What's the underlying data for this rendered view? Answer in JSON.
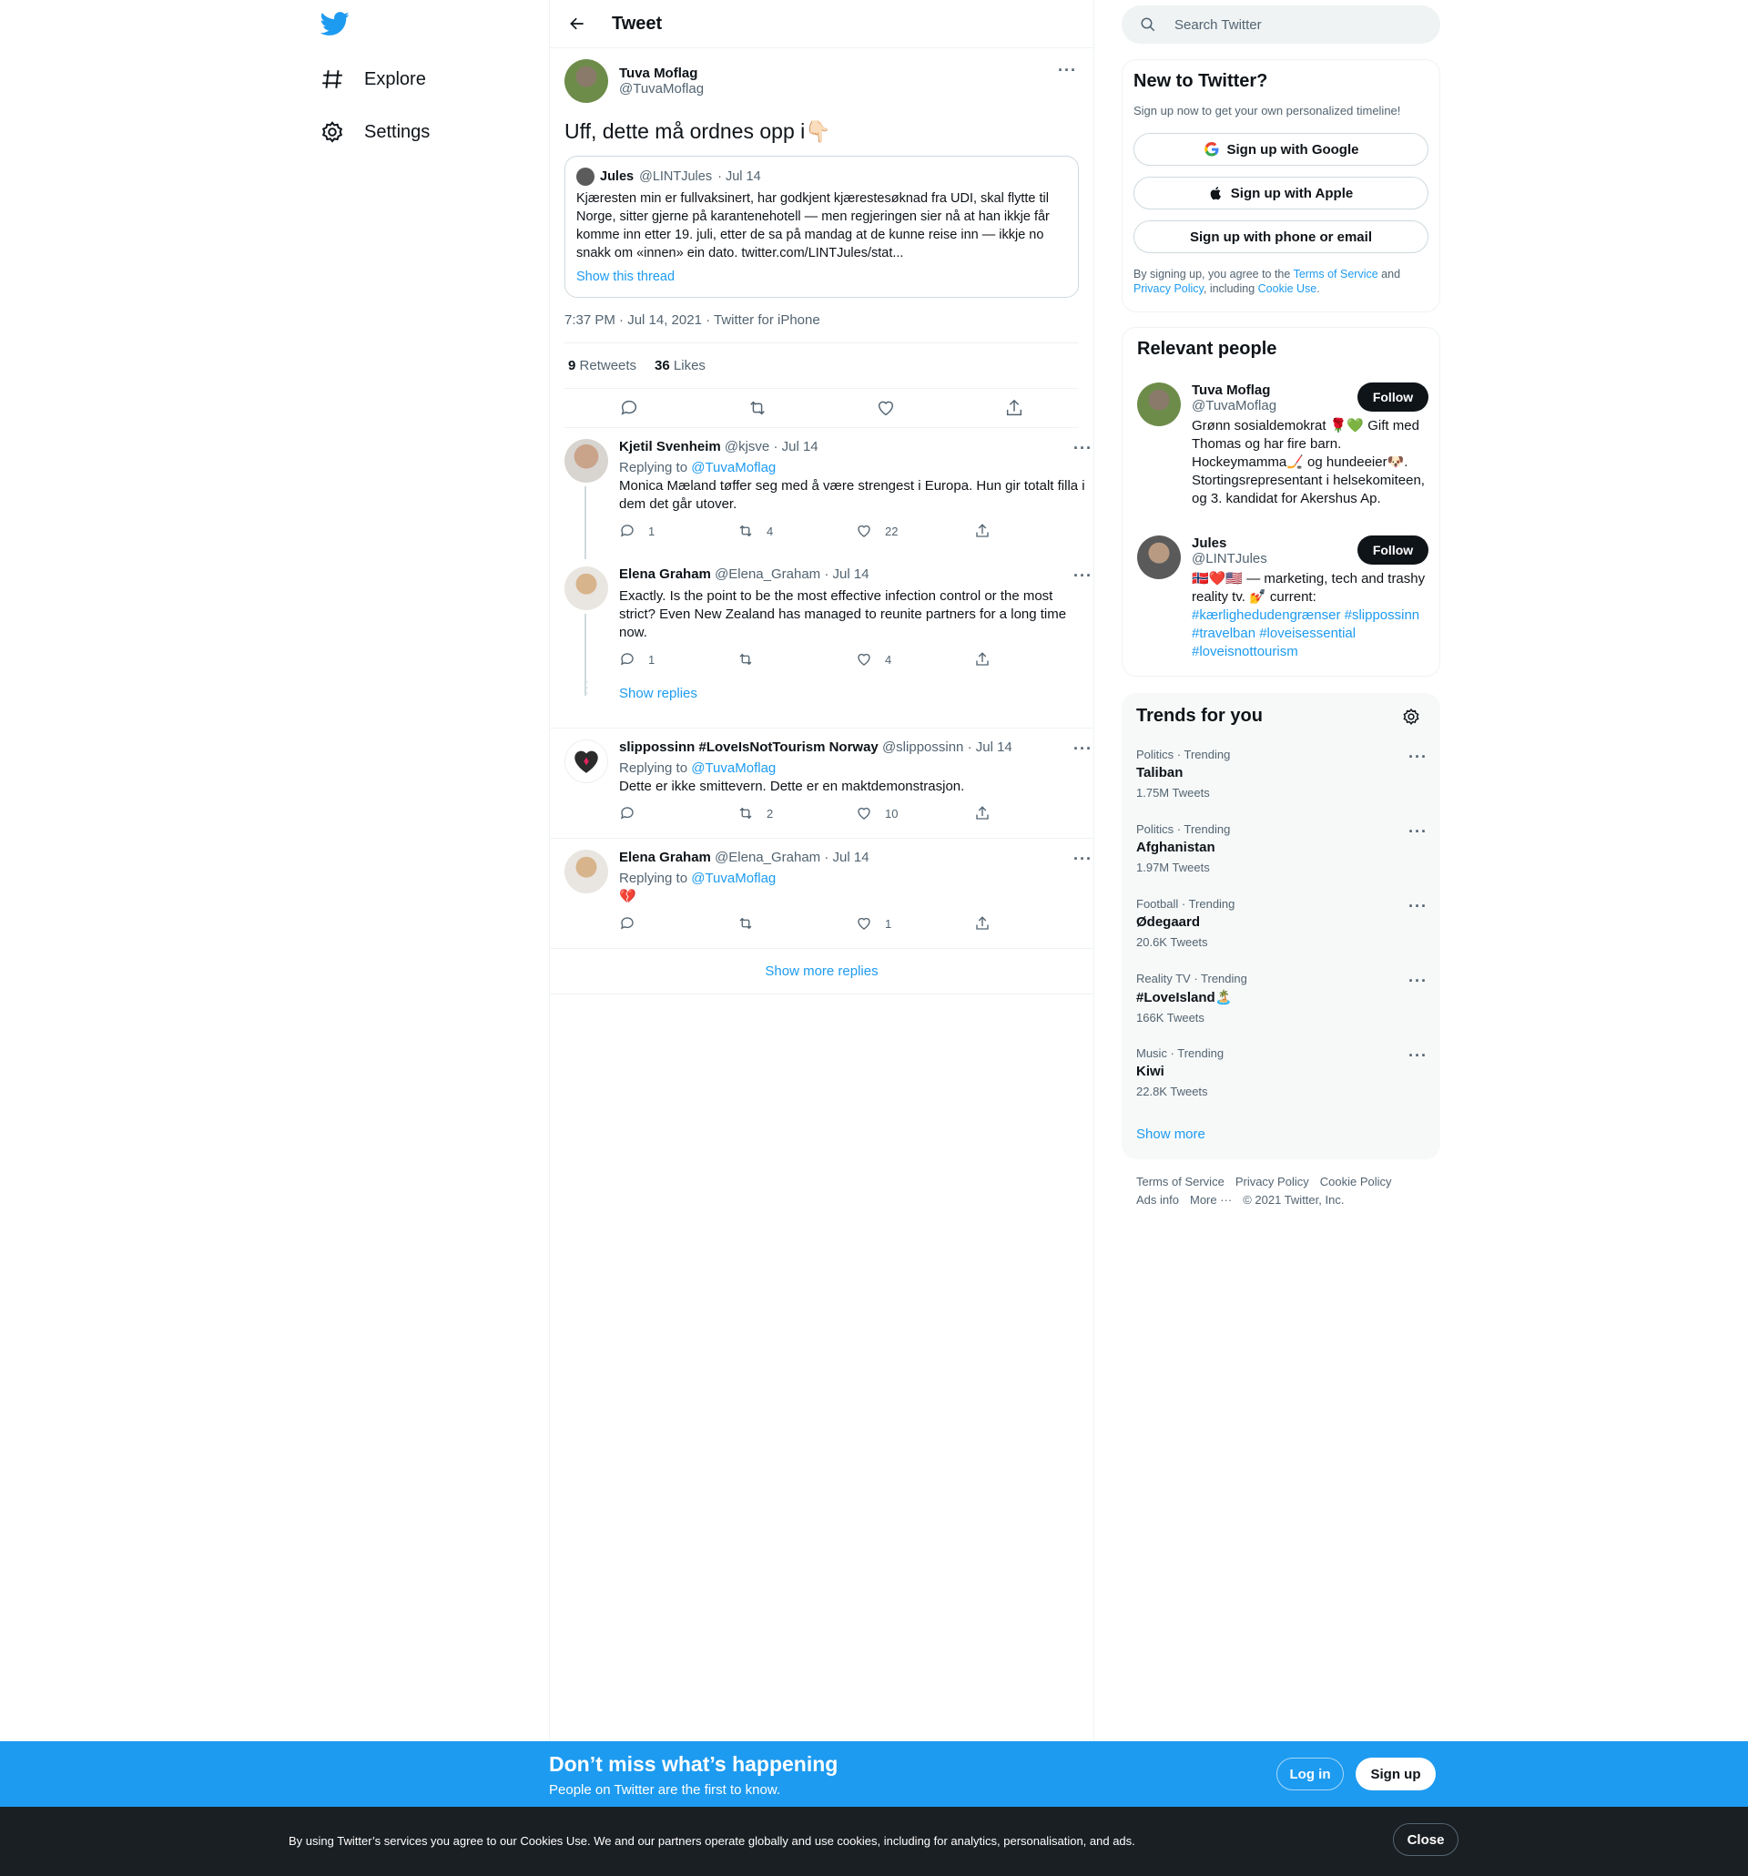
{
  "colors": {
    "accent": "#1d9bf0",
    "text": "#0f1419",
    "muted": "#536471",
    "banner": "#1d9bf0",
    "cookie_bar": "#1a1f23",
    "heart": "#e0245e"
  },
  "nav": {
    "logo": "twitter-bird-icon",
    "items": [
      {
        "label": "Explore",
        "icon": "hashtag-icon"
      },
      {
        "label": "Settings",
        "icon": "gear-icon"
      }
    ]
  },
  "header": {
    "title": "Tweet",
    "back_icon": "arrow-left-icon"
  },
  "tweet": {
    "author_name": "Tuva Moflag",
    "author_handle": "@TuvaMoflag",
    "text": "Uff, dette må ordnes opp i👇🏻",
    "quote": {
      "author_name": "Jules",
      "author_handle": "@LINTJules",
      "date": "· Jul 14",
      "text": "Kjæresten min er fullvaksinert, har godkjent kjærestesøknad fra UDI, skal flytte til Norge, sitter gjerne på karantenehotell — men regjeringen sier nå at han ikkje får komme inn etter 19. juli, etter de sa på mandag at de kunne reise inn — ikkje no snakk om «innen» ein dato. twitter.com/LINTJules/stat...",
      "show_thread": "Show this thread"
    },
    "meta": "7:37 PM · Jul 14, 2021 · Twitter for iPhone",
    "retweets_count": "9",
    "retweets_label": "Retweets",
    "likes_count": "36",
    "likes_label": "Likes"
  },
  "replies": [
    {
      "name": "Kjetil Svenheim",
      "handle": "@kjsve",
      "date": "· Jul 14",
      "replying_prefix": "Replying to ",
      "replying_to": "@TuvaMoflag",
      "text": "Monica Mæland tøffer seg med å være strengest i Europa. Hun gir totalt filla i dem det går utover.",
      "reply_count": "1",
      "retweet_count": "4",
      "like_count": "22"
    },
    {
      "name": "Elena Graham",
      "handle": "@Elena_Graham",
      "date": "· Jul 14",
      "text": "Exactly. Is the point to be the most effective infection control or the most strict? Even New Zealand has managed to reunite partners for a long time now.",
      "reply_count": "1",
      "retweet_count": "",
      "like_count": "4"
    },
    {
      "name": "slippossinn #LoveIsNotTourism Norway",
      "handle": "@slippossinn",
      "date": "· Jul 14",
      "replying_prefix": "Replying to ",
      "replying_to": "@TuvaMoflag",
      "text": "Dette er ikke smittevern. Dette er en maktdemonstrasjon.",
      "reply_count": "",
      "retweet_count": "2",
      "like_count": "10"
    },
    {
      "name": "Elena Graham",
      "handle": "@Elena_Graham",
      "date": "· Jul 14",
      "replying_prefix": "Replying to ",
      "replying_to": "@TuvaMoflag",
      "text": "💔",
      "reply_count": "",
      "retweet_count": "",
      "like_count": "1"
    }
  ],
  "show_replies": "Show replies",
  "show_more_replies": "Show more replies",
  "search": {
    "placeholder": "Search Twitter"
  },
  "new_to_twitter": {
    "title": "New to Twitter?",
    "subtitle": "Sign up now to get your own personalized timeline!",
    "google": "Sign up with Google",
    "apple": "Sign up with Apple",
    "phone": "Sign up with phone or email",
    "legal_1": "By signing up, you agree to the ",
    "terms": "Terms of Service",
    "legal_2": " and ",
    "privacy": "Privacy Policy",
    "legal_3": ", including ",
    "cookie": "Cookie Use",
    "legal_4": "."
  },
  "relevant": {
    "title": "Relevant people",
    "people": [
      {
        "name": "Tuva Moflag",
        "handle": "@TuvaMoflag",
        "bio": "Grønn sosialdemokrat 🌹💚 Gift med Thomas og har fire barn. Hockeymamma🏒 og hundeeier🐶. Stortingsrepresentant i helsekomiteen, og 3. kandidat for Akershus Ap.",
        "follow": "Follow"
      },
      {
        "name": "Jules",
        "handle": "@LINTJules",
        "bio_prefix": "🇳🇴❤️🇺🇸 — marketing, tech and trashy reality tv. 💅 current: ",
        "bio_tags": "#kærlighedudengrænser #slippossinn #travelban #loveisessential #loveisnottourism",
        "follow": "Follow"
      }
    ]
  },
  "trends": {
    "title": "Trends for you",
    "items": [
      {
        "category": "Politics · Trending",
        "name": "Taliban",
        "count": "1.75M Tweets"
      },
      {
        "category": "Politics · Trending",
        "name": "Afghanistan",
        "count": "1.97M Tweets"
      },
      {
        "category": "Football · Trending",
        "name": "Ødegaard",
        "count": "20.6K Tweets"
      },
      {
        "category": "Reality TV · Trending",
        "name": "#LoveIsland🏝️",
        "count": "166K Tweets"
      },
      {
        "category": "Music · Trending",
        "name": "Kiwi",
        "count": "22.8K Tweets"
      }
    ],
    "show_more": "Show more"
  },
  "footer": {
    "terms": "Terms of Service",
    "privacy": "Privacy Policy",
    "cookie": "Cookie Policy",
    "ads": "Ads info",
    "more": "More ···",
    "copyright": "© 2021 Twitter, Inc."
  },
  "banner": {
    "title": "Don’t miss what’s happening",
    "subtitle": "People on Twitter are the first to know.",
    "login": "Log in",
    "signup": "Sign up"
  },
  "cookies": {
    "text": "By using Twitter’s services you agree to our Cookies Use. We and our partners operate globally and use cookies, including for analytics, personalisation, and ads.",
    "close": "Close"
  }
}
